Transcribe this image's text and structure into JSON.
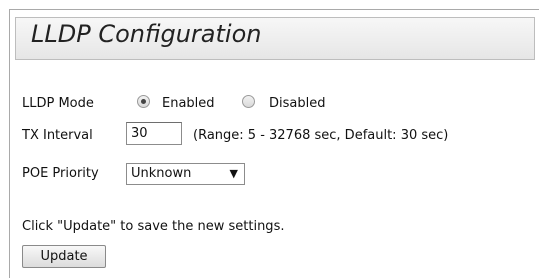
{
  "panel": {
    "title": "LLDP Configuration"
  },
  "lldp_mode": {
    "label": "LLDP Mode",
    "options": [
      {
        "label": "Enabled",
        "selected": true
      },
      {
        "label": "Disabled",
        "selected": false
      }
    ]
  },
  "tx_interval": {
    "label": "TX Interval",
    "value": "30",
    "hint": "(Range: 5 - 32768 sec, Default: 30 sec)"
  },
  "poe_priority": {
    "label": "POE Priority",
    "selected": "Unknown",
    "caret": "▼"
  },
  "footer": {
    "note": "Click \"Update\" to save the new settings.",
    "update_label": "Update"
  }
}
